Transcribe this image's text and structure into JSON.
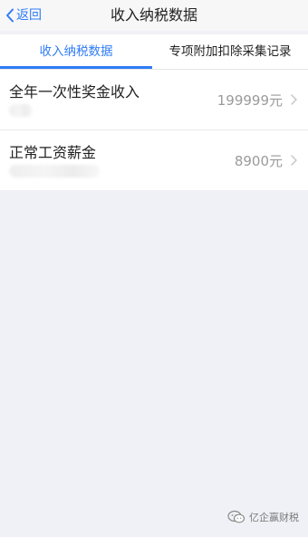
{
  "nav": {
    "back_label": "返回",
    "title": "收入纳税数据",
    "back_icon": "chevron-left-icon"
  },
  "tabs": [
    {
      "label": "收入纳税数据",
      "active": true
    },
    {
      "label": "专项附加扣除采集记录",
      "active": false
    }
  ],
  "list": [
    {
      "title": "全年一次性奖金收入",
      "value": "199999元"
    },
    {
      "title": "正常工资薪金",
      "value": "8900元"
    }
  ],
  "watermark": {
    "text": "亿企赢财税",
    "icon": "wechat-icon"
  },
  "colors": {
    "accent": "#2f7cf6",
    "background": "#eff1f6",
    "value_text": "#9a9a9a"
  }
}
